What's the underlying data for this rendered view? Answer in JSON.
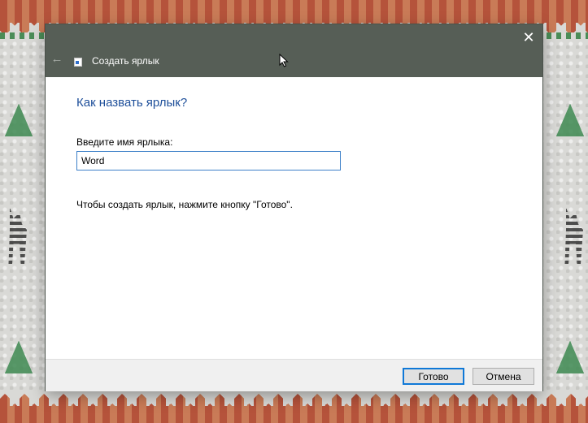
{
  "dialog": {
    "window_title": "Создать ярлык",
    "heading": "Как назвать ярлык?",
    "field_label": "Введите имя ярлыка:",
    "name_value": "Word",
    "hint": "Чтобы создать ярлык, нажмите кнопку \"Готово\".",
    "close_glyph": "✕",
    "back_glyph": "←",
    "buttons": {
      "finish": "Готово",
      "cancel": "Отмена"
    }
  },
  "icons": {
    "close": "close-icon",
    "back": "back-arrow-icon",
    "wizard": "shortcut-wizard-icon",
    "cursor": "mouse-cursor-icon"
  },
  "colors": {
    "titlebar": "#565e56",
    "heading": "#1e4f9a",
    "input_border": "#3c7fc8",
    "primary_button_border": "#0f78d7",
    "footer": "#f0f0f0"
  }
}
